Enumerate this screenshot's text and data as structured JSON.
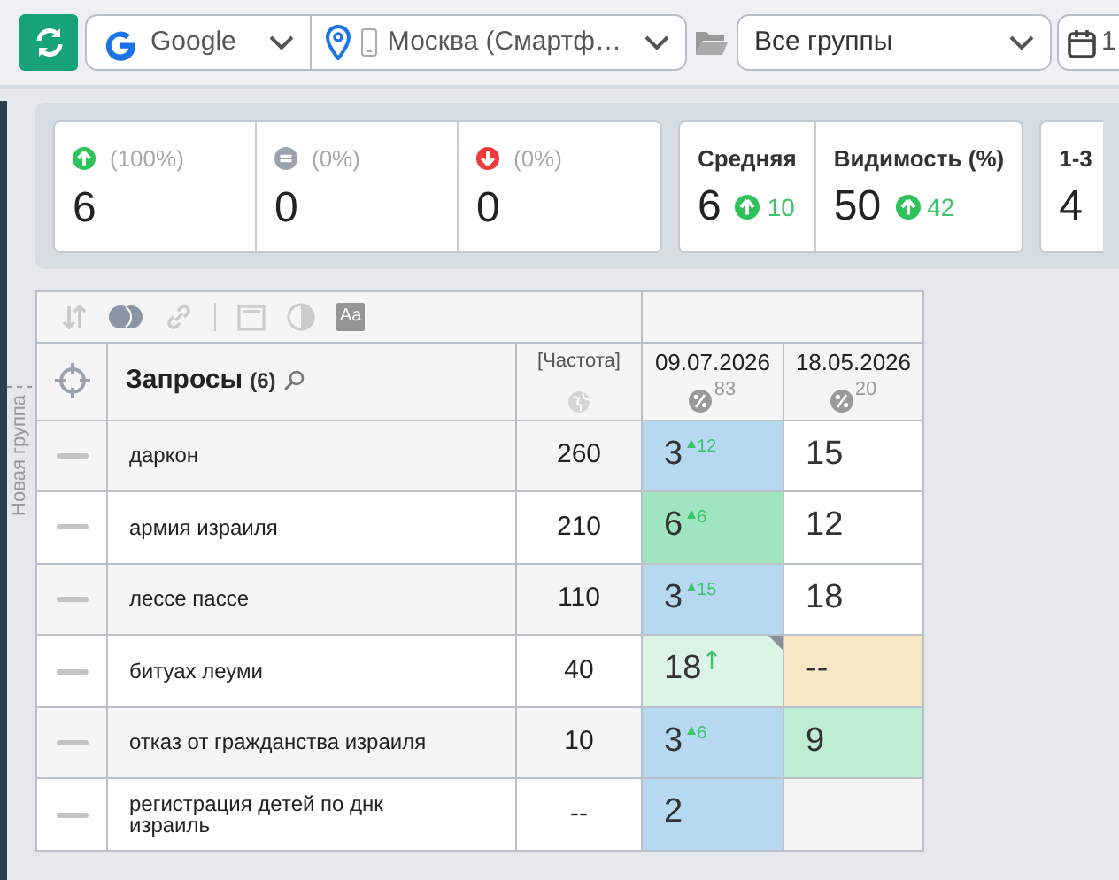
{
  "toolbar": {
    "engine": "Google",
    "region": "Москва (Смартф…",
    "group": "Все группы",
    "date_partial": "1"
  },
  "stats": [
    {
      "kind": "up",
      "percent": "(100%)",
      "value": "6"
    },
    {
      "kind": "flat",
      "percent": "(0%)",
      "value": "0"
    },
    {
      "kind": "down",
      "percent": "(0%)",
      "value": "0"
    }
  ],
  "summary": [
    {
      "label": "Средняя",
      "value": "6",
      "kind": "up",
      "delta": "10"
    },
    {
      "label": "Видимость (%)",
      "value": "50",
      "kind": "up",
      "delta": "42"
    }
  ],
  "summary_partial": {
    "label": "1-3",
    "value": "4"
  },
  "group_label": "Новая группа",
  "table": {
    "font_tool_label": "Aa",
    "query_header": "Запросы",
    "query_count": "(6)",
    "freq_header": "[Частота]",
    "dates": [
      {
        "date": "09.07.2026",
        "visibility": "83"
      },
      {
        "date": "18.05.2026",
        "visibility": "20"
      }
    ],
    "rows": [
      {
        "query": "даркон",
        "frequency": "260",
        "positions": [
          {
            "value": "3",
            "rising": true,
            "delta": "12",
            "color": "#b6d8f1"
          },
          {
            "value": "15",
            "color": "#ffffff"
          }
        ]
      },
      {
        "query": "армия израиля",
        "frequency": "210",
        "positions": [
          {
            "value": "6",
            "rising": true,
            "delta": "6",
            "color": "#9fe6c0"
          },
          {
            "value": "12"
          }
        ]
      },
      {
        "query": "лессе пассе",
        "frequency": "110",
        "positions": [
          {
            "value": "3",
            "rising": true,
            "delta": "15",
            "color": "#b6d8f1"
          },
          {
            "value": "18",
            "color": "#ffffff"
          }
        ]
      },
      {
        "query": "битуах леуми",
        "frequency": "40",
        "positions": [
          {
            "value": "18",
            "rising": true,
            "flagged": true,
            "color": "#dcf4e6"
          },
          {
            "value": "--",
            "color": "#f6e7c5"
          }
        ]
      },
      {
        "query": "отказ от гражданства израиля",
        "frequency": "10",
        "positions": [
          {
            "value": "3",
            "rising": true,
            "delta": "6",
            "color": "#b6d8f1"
          },
          {
            "value": "9",
            "color": "#bdeed4"
          }
        ]
      },
      {
        "query": "регистрация детей по днк израиль",
        "frequency": "--",
        "positions": [
          {
            "value": "2",
            "color": "#b6d8f1"
          },
          {
            "color": "#f5f5f5"
          }
        ]
      }
    ]
  }
}
